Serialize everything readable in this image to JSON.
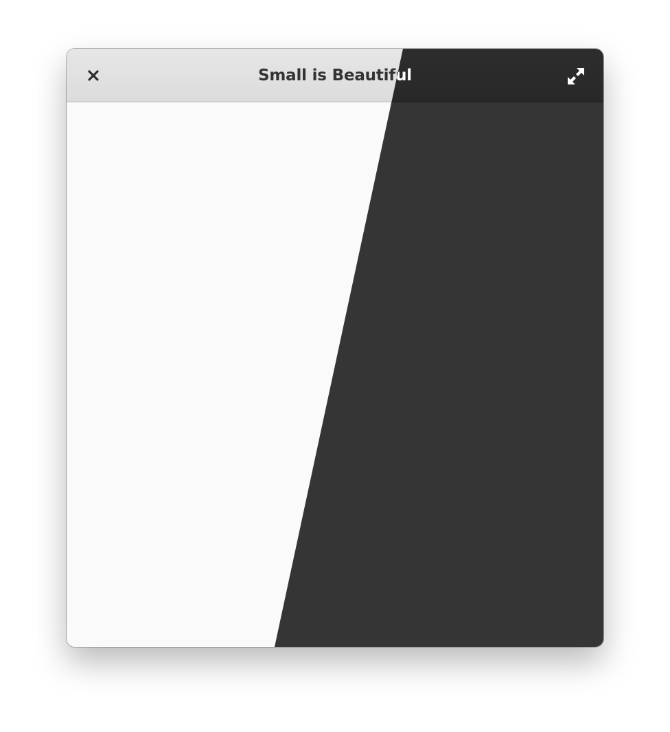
{
  "window": {
    "title": "Small is Beautiful",
    "close_icon": "close-icon",
    "maximize_icon": "maximize-icon"
  },
  "theme": {
    "light_headerbar": "#dfdfdf",
    "light_content": "#fafafa",
    "dark_headerbar": "#2b2b2b",
    "dark_content": "#353535",
    "light_text": "#333333",
    "dark_text": "#ffffff"
  }
}
